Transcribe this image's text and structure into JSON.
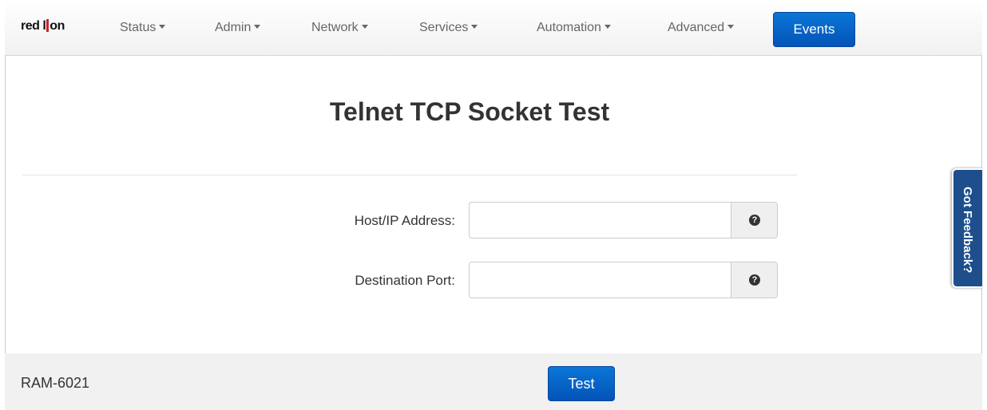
{
  "brand": {
    "logo_text_left": "red l",
    "logo_text_right": "on"
  },
  "nav": {
    "items": [
      {
        "label": "Status"
      },
      {
        "label": "Admin"
      },
      {
        "label": "Network"
      },
      {
        "label": "Services"
      },
      {
        "label": "Automation"
      },
      {
        "label": "Advanced"
      }
    ],
    "events_label": "Events"
  },
  "page": {
    "title": "Telnet TCP Socket Test"
  },
  "form": {
    "host": {
      "label": "Host/IP Address:",
      "value": "",
      "help": "?"
    },
    "port": {
      "label": "Destination Port:",
      "value": "",
      "help": "?"
    }
  },
  "footer": {
    "device_name": "RAM-6021",
    "test_label": "Test"
  },
  "feedback": {
    "label": "Got Feedback?"
  },
  "colors": {
    "primary": "#0a6fd1",
    "feedback": "#1e4f8c"
  }
}
